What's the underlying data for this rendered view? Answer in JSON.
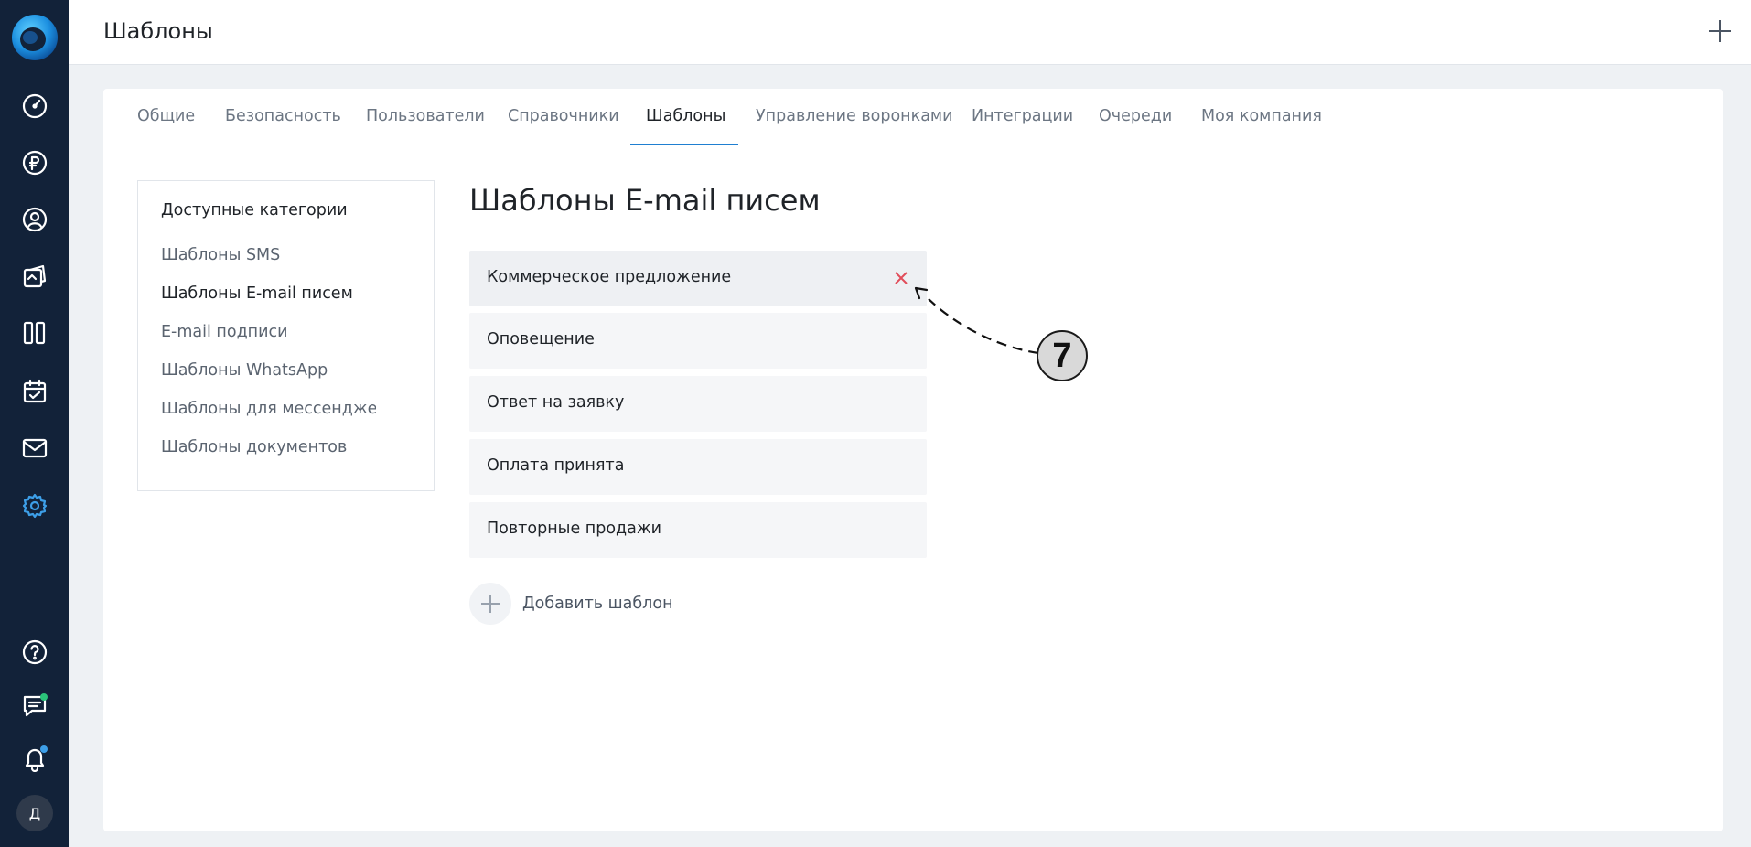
{
  "header": {
    "title": "Шаблоны"
  },
  "tabs": [
    {
      "label": "Общие"
    },
    {
      "label": "Безопасность"
    },
    {
      "label": "Пользователи"
    },
    {
      "label": "Справочники"
    },
    {
      "label": "Шаблоны",
      "active": true
    },
    {
      "label": "Управление воронками"
    },
    {
      "label": "Интеграции"
    },
    {
      "label": "Очереди"
    },
    {
      "label": "Моя компания"
    }
  ],
  "categories": {
    "title": "Доступные категории",
    "items": [
      {
        "label": "Шаблоны SMS"
      },
      {
        "label": "Шаблоны E-mail писем",
        "active": true
      },
      {
        "label": "E-mail подписи"
      },
      {
        "label": "Шаблоны WhatsApp"
      },
      {
        "label": "Шаблоны для мессенджера"
      },
      {
        "label": "Шаблоны документов"
      }
    ]
  },
  "main": {
    "title": "Шаблоны E-mail писем",
    "templates": [
      {
        "label": "Коммерческое предложение"
      },
      {
        "label": "Оповещение"
      },
      {
        "label": "Ответ на заявку"
      },
      {
        "label": "Оплата принята"
      },
      {
        "label": "Повторные продажи"
      }
    ],
    "add_label": "Добавить шаблон"
  },
  "annotation": {
    "number": "7"
  },
  "user": {
    "avatar_letter": "Д"
  },
  "colors": {
    "sidebar": "#122239",
    "accent": "#1f7fd1",
    "active_icon": "#3d9fe8",
    "delete": "#e14d5a"
  },
  "icons": [
    "logo-icon",
    "dashboard-icon",
    "ruble-icon",
    "user-circle-icon",
    "documents-icon",
    "kanban-icon",
    "calendar-icon",
    "mail-icon",
    "settings-icon",
    "help-icon",
    "chat-icon",
    "bell-icon",
    "plus-icon",
    "close-icon"
  ]
}
